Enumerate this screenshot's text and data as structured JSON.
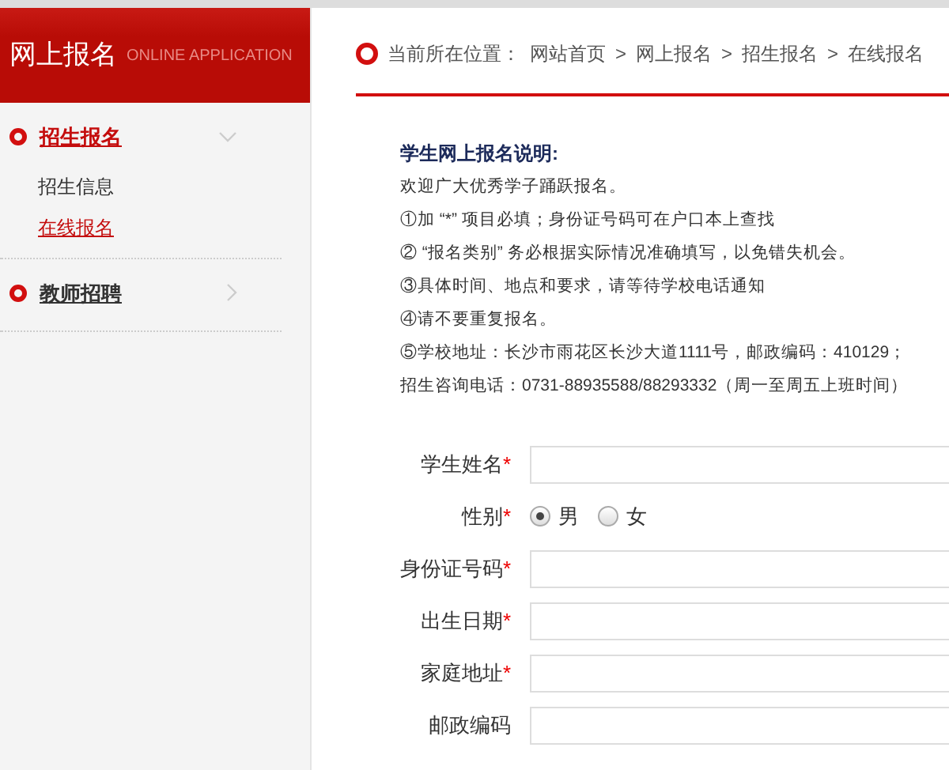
{
  "sidebar": {
    "title": "网上报名",
    "subtitle": "ONLINE APPLICATION",
    "items": [
      {
        "label": "招生报名",
        "expanded": true,
        "children": [
          {
            "label": "招生信息",
            "selected": false
          },
          {
            "label": "在线报名",
            "selected": true
          }
        ]
      },
      {
        "label": "教师招聘",
        "expanded": false
      }
    ]
  },
  "breadcrumb": {
    "label": "当前所在位置：",
    "items": [
      "网站首页",
      "网上报名",
      "招生报名",
      "在线报名"
    ],
    "separator": ">"
  },
  "notes": {
    "title": "学生网上报名说明:",
    "lines": [
      "欢迎广大优秀学子踊跃报名。",
      "①加 “*” 项目必填；身份证号码可在户口本上查找",
      "② “报名类别” 务必根据实际情况准确填写，以免错失机会。",
      "③具体时间、地点和要求，请等待学校电话通知",
      "④请不要重复报名。",
      "⑤学校地址：长沙市雨花区长沙大道1111号，邮政编码：410129；",
      "招生咨询电话：0731-88935588/88293332（周一至周五上班时间）"
    ]
  },
  "form": {
    "required_mark": "*",
    "fields": [
      {
        "kind": "text",
        "label": "学生姓名",
        "required": true
      },
      {
        "kind": "radio",
        "label": "性别",
        "required": true,
        "options": [
          {
            "label": "男",
            "selected": true
          },
          {
            "label": "女",
            "selected": false
          }
        ]
      },
      {
        "kind": "text",
        "label": "身份证号码",
        "required": true
      },
      {
        "kind": "text",
        "label": "出生日期",
        "required": true
      },
      {
        "kind": "text",
        "label": "家庭地址",
        "required": true
      },
      {
        "kind": "text",
        "label": "邮政编码",
        "required": false
      }
    ]
  }
}
